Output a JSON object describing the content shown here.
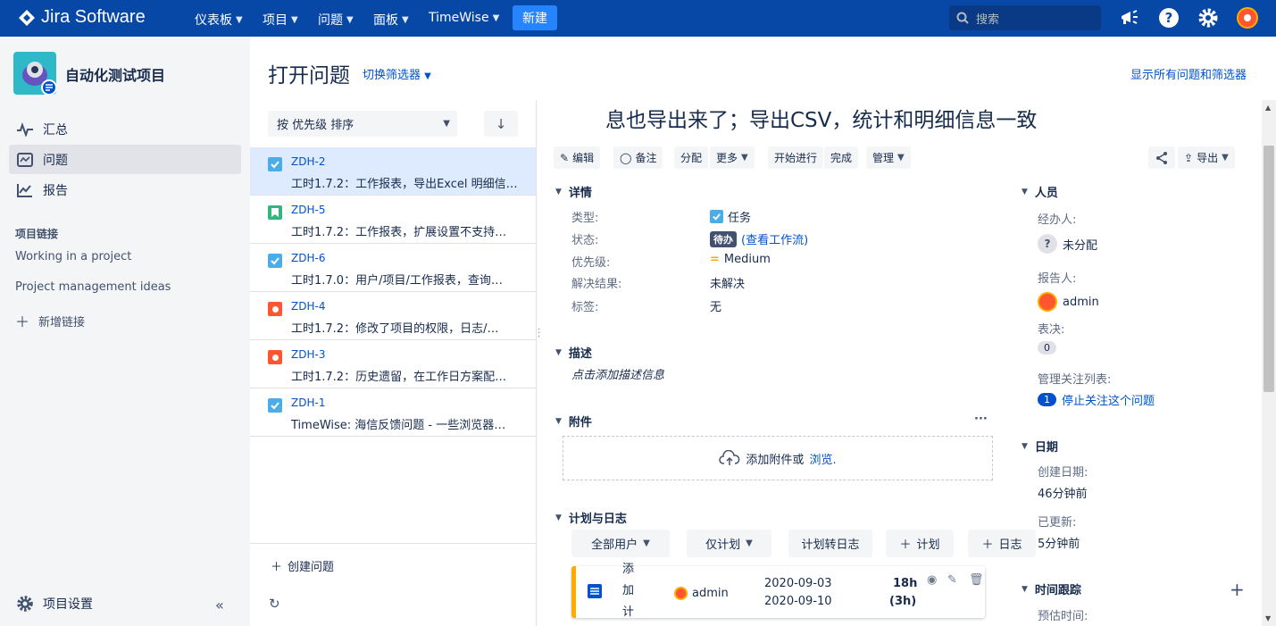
{
  "topnav": {
    "product": "Jira Software",
    "items": [
      {
        "label": "仪表板"
      },
      {
        "label": "项目"
      },
      {
        "label": "问题"
      },
      {
        "label": "面板"
      },
      {
        "label": "TimeWise"
      }
    ],
    "create_label": "新建",
    "search_placeholder": "搜索",
    "brand_color": "#0747a6"
  },
  "sidebar": {
    "project_name": "自动化测试项目",
    "nav": [
      {
        "label": "汇总",
        "icon": "pulse-icon"
      },
      {
        "label": "问题",
        "icon": "issues-icon"
      },
      {
        "label": "报告",
        "icon": "chart-icon"
      }
    ],
    "links_heading": "项目链接",
    "links": [
      "Working in a project",
      "Project management ideas"
    ],
    "add_link": "新增链接",
    "settings": "项目设置"
  },
  "main": {
    "title": "打开问题",
    "switch_filter": "切换筛选器",
    "show_all": "显示所有问题和筛选器"
  },
  "list": {
    "sort_label": "按 优先级 排序",
    "issues": [
      {
        "key": "ZDH-2",
        "summary": "工时1.7.2：工作报表，导出Excel 明细信息也导出来了；导出CSV，统计和明细信息一致",
        "type": "task"
      },
      {
        "key": "ZDH-5",
        "summary": "工时1.7.2：工作报表，扩展设置不支持…",
        "type": "story"
      },
      {
        "key": "ZDH-6",
        "summary": "工时1.7.0：用户/项目/工作报表，查询…",
        "type": "task"
      },
      {
        "key": "ZDH-4",
        "summary": "工时1.7.2：修改了项目的权限，日志/…",
        "type": "bug"
      },
      {
        "key": "ZDH-3",
        "summary": "工时1.7.2：历史遗留，在工作日方案配…",
        "type": "bug"
      },
      {
        "key": "ZDH-1",
        "summary": "TimeWise: 海信反馈问题 - 一些浏览器…",
        "type": "task"
      }
    ],
    "create_issue": "创建问题"
  },
  "detail": {
    "title_visible": "息也导出来了；导出CSV，统计和明细信息一致",
    "buttons": {
      "edit": "编辑",
      "comment": "备注",
      "assign": "分配",
      "more": "更多",
      "start": "开始进行",
      "done": "完成",
      "admin": "管理",
      "export": "导出"
    },
    "details_heading": "详情",
    "fields": {
      "type_label": "类型:",
      "type_value": "任务",
      "status_label": "状态:",
      "status_value": "待办",
      "workflow_link": "(查看工作流)",
      "priority_label": "优先级:",
      "priority_value": "Medium",
      "resolution_label": "解决结果:",
      "resolution_value": "未解决",
      "labels_label": "标签:",
      "labels_value": "无"
    },
    "description_heading": "描述",
    "description_placeholder": "点击添加描述信息",
    "attachments_heading": "附件",
    "attach_text": "添加附件或",
    "attach_link": "浏览.",
    "plan_heading": "计划与日志",
    "plan_buttons": {
      "all_users": "全部用户",
      "only_plan": "仅计划",
      "plan_to_log": "计划转日志",
      "plan": "计划",
      "log": "日志"
    },
    "plan_card": {
      "label": "添加计划",
      "user": "admin",
      "start": "2020-09-03",
      "end": "2020-09-10",
      "hours": "18h",
      "sub_hours": "(3h)"
    }
  },
  "right": {
    "people_heading": "人员",
    "assignee_label": "经办人:",
    "assignee_value": "未分配",
    "reporter_label": "报告人:",
    "reporter_value": "admin",
    "votes_label": "表决:",
    "votes_value": "0",
    "watchers_label": "管理关注列表:",
    "watchers_count": "1",
    "watchers_link": "停止关注这个问题",
    "dates_heading": "日期",
    "created_label": "创建日期:",
    "created_value": "46分钟前",
    "updated_label": "已更新:",
    "updated_value": "5分钟前",
    "time_heading": "时间跟踪",
    "estimate_label": "预估时间:"
  }
}
